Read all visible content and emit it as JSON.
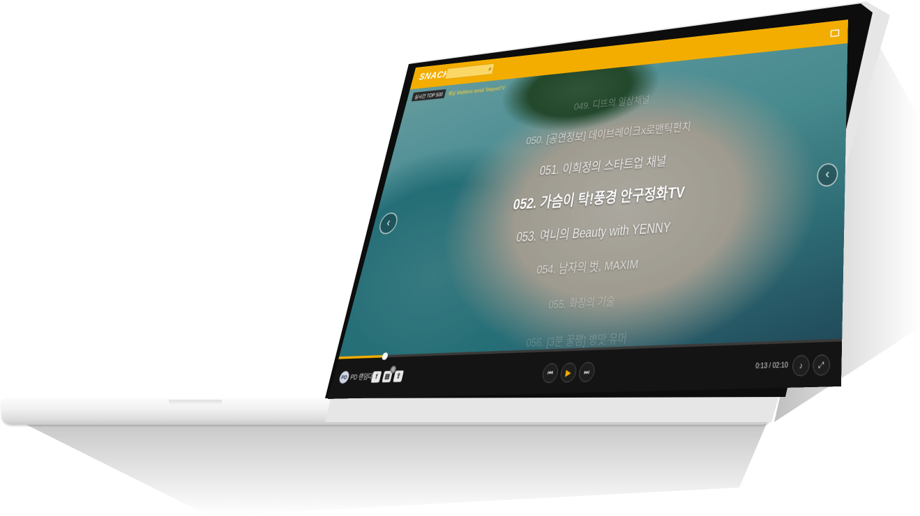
{
  "player": {
    "logo": "SNACKK",
    "top_label": "실시간 TOP 500",
    "ticker": "채널 Maldives aerial TeleportTV",
    "playlist": [
      "049. 디뜨의 일상채널",
      "050. [공연정보] 데이브레이크x로맨틱펀치",
      "051. 이희정의 스타트업 채널",
      "052. 가슴이 탁!풍경 안구정화TV",
      "053. 여니의 Beauty with YENNY",
      "054. 남자의 벗, MAXIM",
      "055. 화장의 기술",
      "056. [3분 꿀잼] 병맛 유머"
    ],
    "current_index": 3,
    "progress_fraction": 0.103,
    "time": "0:13 / 02:10",
    "pd_label": "PD 랜덤다",
    "comment_count": "0",
    "colors": {
      "accent": "#f3ad00",
      "bar": "#141414"
    },
    "icons": {
      "search": "search-icon",
      "fullscreen": "screen-icon",
      "prev": "skip-back-icon",
      "play": "play-icon",
      "next": "skip-forward-icon",
      "volume": "volume-icon",
      "expand": "expand-icon",
      "facebook": "facebook-icon",
      "comment": "comment-icon",
      "share": "share-icon"
    }
  }
}
